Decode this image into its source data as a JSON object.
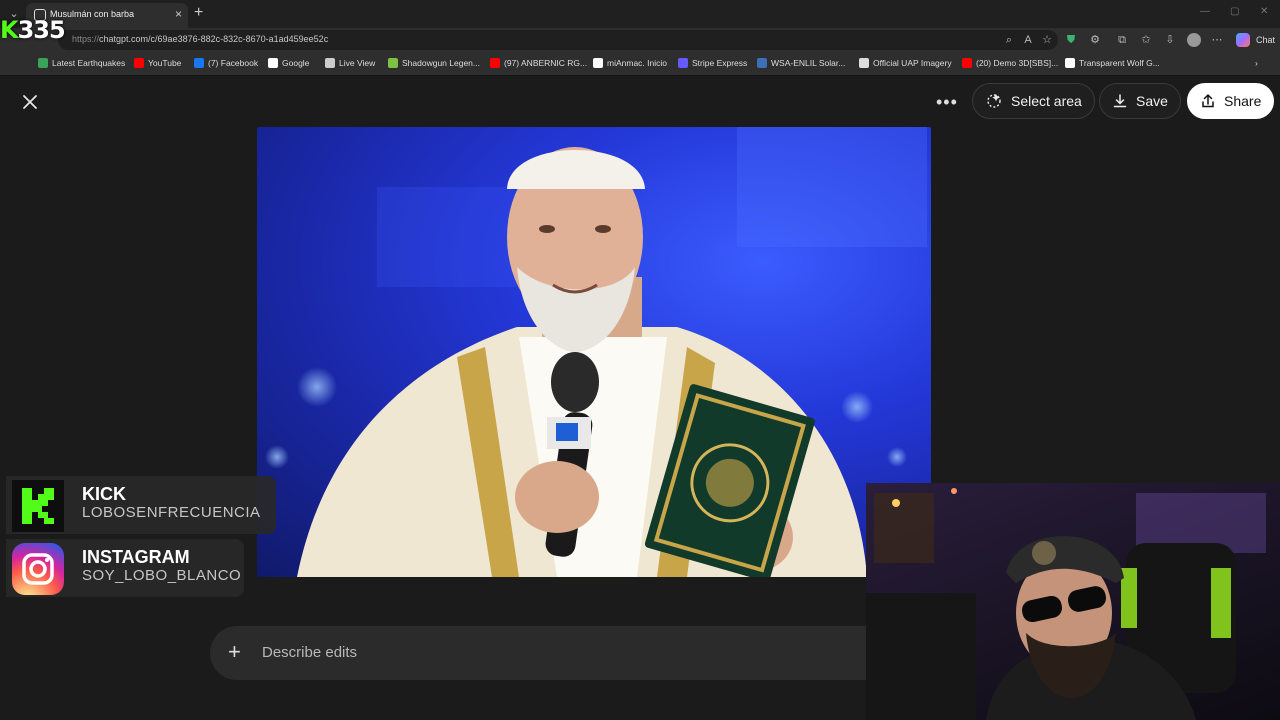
{
  "browser": {
    "tab_title": "Musulmán con barba",
    "url_protocol": "https://",
    "url_host": "chatgpt.com",
    "url_path": "/c/69ae3876-882c-832c-8670-a1ad459ee52c",
    "chat_label": "Chat"
  },
  "stream_counter": {
    "k": "K",
    "count": "335"
  },
  "bookmarks": [
    {
      "label": "Latest Earthquakes",
      "color": "#3aa35b"
    },
    {
      "label": "YouTube",
      "color": "#ff0000"
    },
    {
      "label": "(7) Facebook",
      "color": "#1877f2"
    },
    {
      "label": "Google",
      "color": "#ffffff"
    },
    {
      "label": "Live View",
      "color": "#cccccc"
    },
    {
      "label": "Shadowgun Legen...",
      "color": "#7cc242"
    },
    {
      "label": "(97) ANBERNIC RG...",
      "color": "#ff0000"
    },
    {
      "label": "miAnmac. Inicio",
      "color": "#ffffff"
    },
    {
      "label": "Stripe Express",
      "color": "#635bff"
    },
    {
      "label": "WSA-ENLIL Solar...",
      "color": "#3b6fb6"
    },
    {
      "label": "Official UAP Imagery",
      "color": "#dddddd"
    },
    {
      "label": "(20) Demo 3D[SBS]...",
      "color": "#ff0000"
    },
    {
      "label": "Transparent Wolf G...",
      "color": "#ffffff"
    }
  ],
  "viewer": {
    "select_area": "Select area",
    "save": "Save",
    "share": "Share",
    "describe_placeholder": "Describe edits"
  },
  "socials": {
    "kick": {
      "name": "KICK",
      "handle": "LOBOSENFRECUENCIA"
    },
    "instagram": {
      "name": "INSTAGRAM",
      "handle": "SOY_LOBO_BLANCO"
    }
  },
  "colors": {
    "kick_green": "#53fc18",
    "viewer_bg": "#1b1b1b",
    "photo_blue": "#2438d8"
  }
}
